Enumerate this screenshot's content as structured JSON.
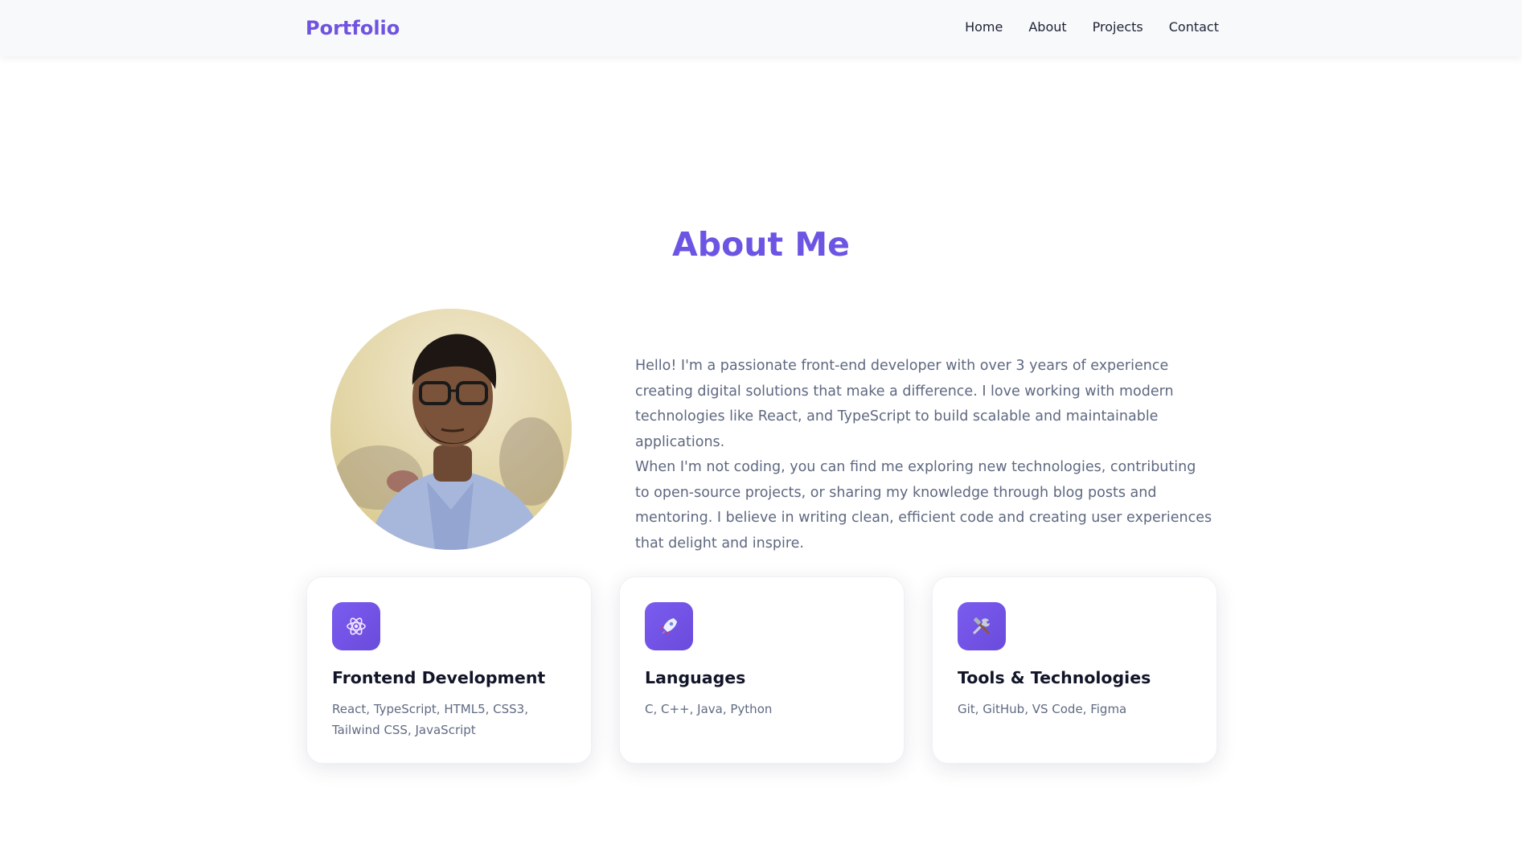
{
  "nav": {
    "brand": "Portfolio",
    "links": [
      "Home",
      "About",
      "Projects",
      "Contact"
    ]
  },
  "about": {
    "title": "About Me",
    "paragraphs": [
      "Hello! I'm a passionate front-end developer with over 3 years of experience creating digital solutions that make a difference. I love working with modern technologies like React, and TypeScript to build scalable and maintainable applications.",
      "When I'm not coding, you can find me exploring new technologies, contributing to open-source projects, or sharing my knowledge through blog posts and mentoring. I believe in writing clean, efficient code and creating user experiences that delight and inspire."
    ]
  },
  "cards": [
    {
      "icon": "atom-icon",
      "title": "Frontend Development",
      "text": "React, TypeScript, HTML5, CSS3, Tailwind CSS, JavaScript"
    },
    {
      "icon": "rocket-icon",
      "title": "Languages",
      "text": "C, C++, Java, Python"
    },
    {
      "icon": "tools-icon",
      "title": "Tools & Technologies",
      "text": "Git, GitHub, VS Code, Figma"
    }
  ],
  "colors": {
    "accent": "#6d55e3",
    "nav_bg": "#f8f9fb",
    "heading": "#121528",
    "body_text": "#5e6880"
  }
}
